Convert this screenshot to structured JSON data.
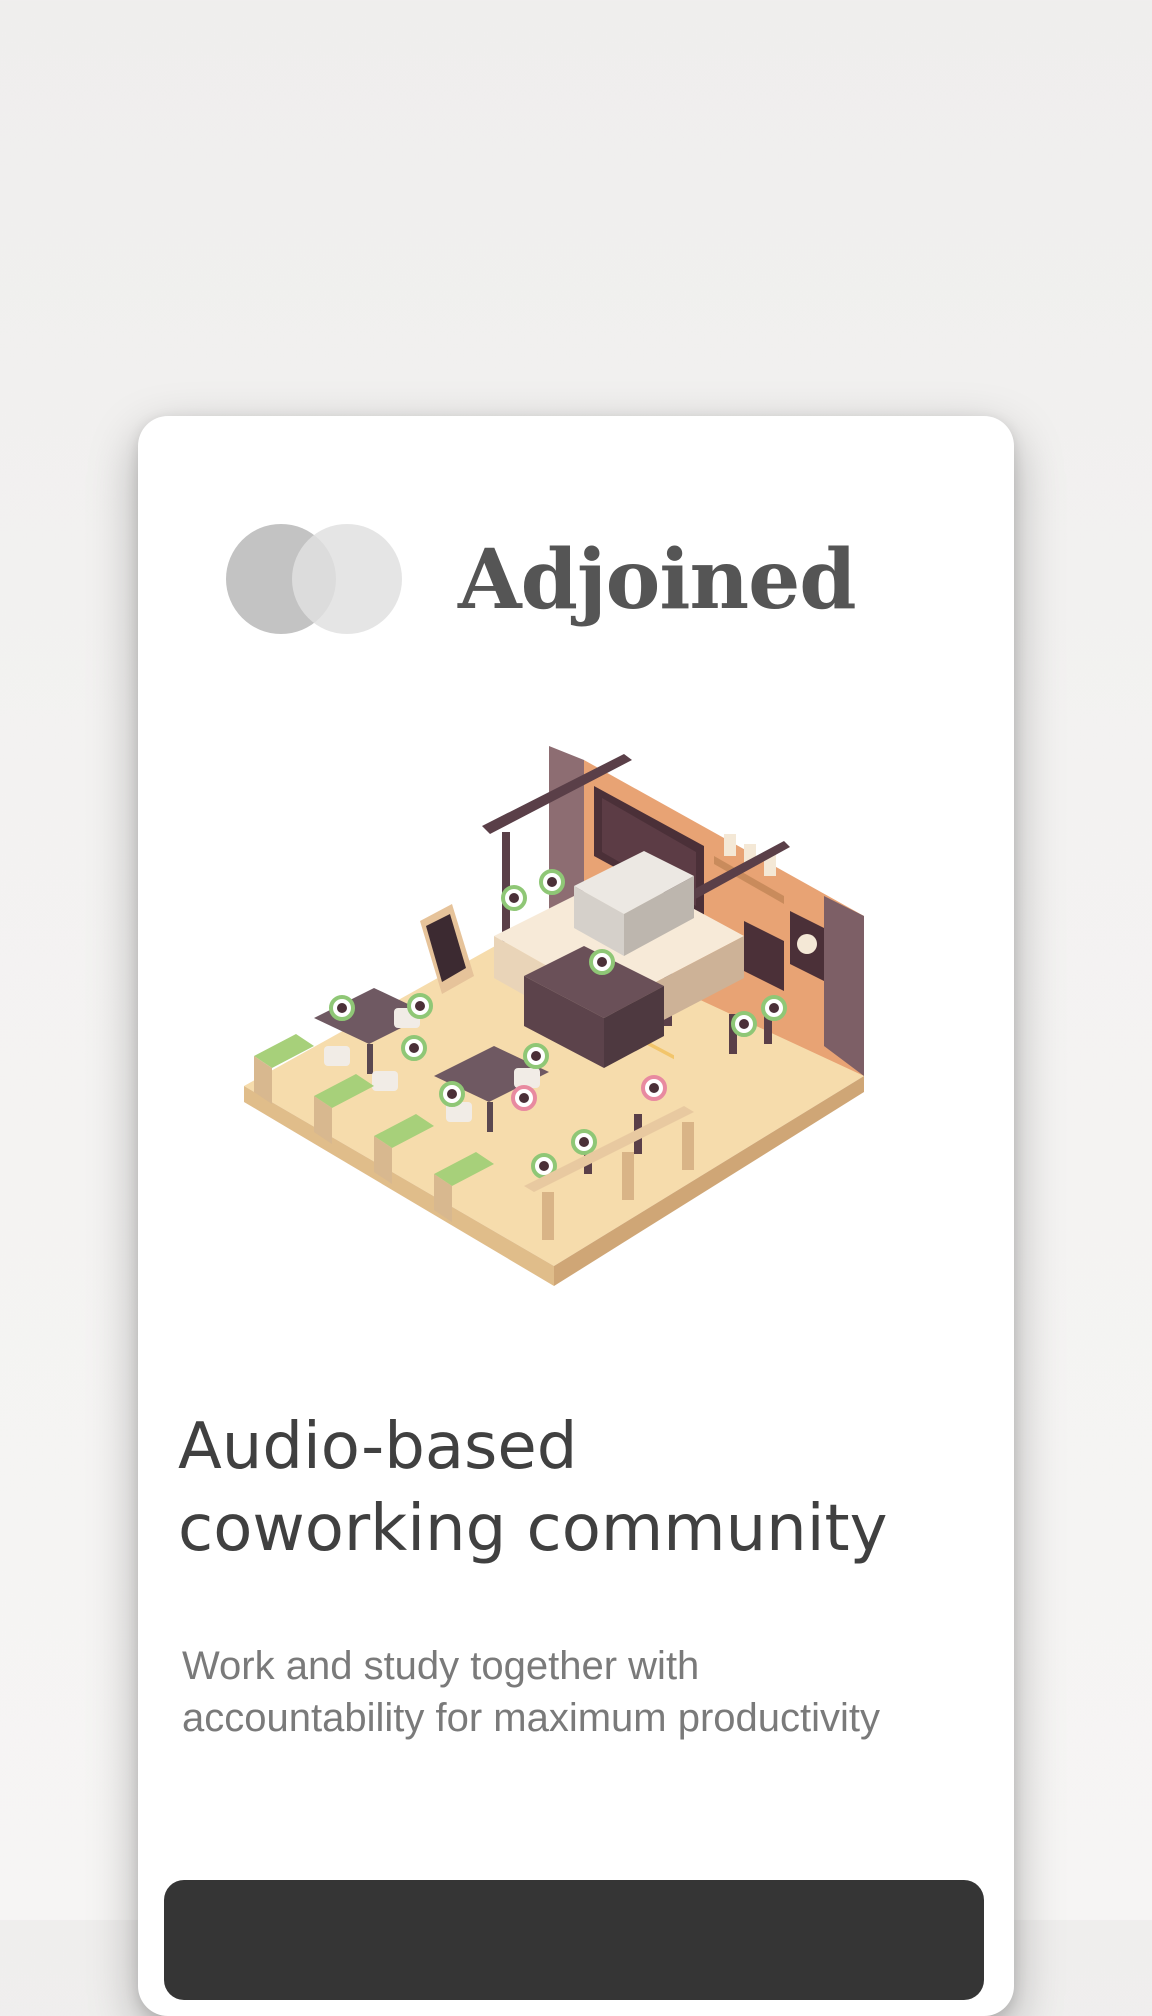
{
  "brand": {
    "name": "Adjoined"
  },
  "hero": {
    "headline_line1": "Audio-based",
    "headline_line2": "coworking community",
    "subtitle_line1": "Work and study together with",
    "subtitle_line2": "accountability for maximum productivity",
    "illustration": "isometric-coffee-shop-illustration"
  },
  "cta": {
    "label": ""
  },
  "colors": {
    "background": "#f1f0ef",
    "card": "#ffffff",
    "brand_text": "#555555",
    "headline_text": "#404040",
    "subtitle_text": "#7a7a7a",
    "cta_background": "#353535"
  }
}
